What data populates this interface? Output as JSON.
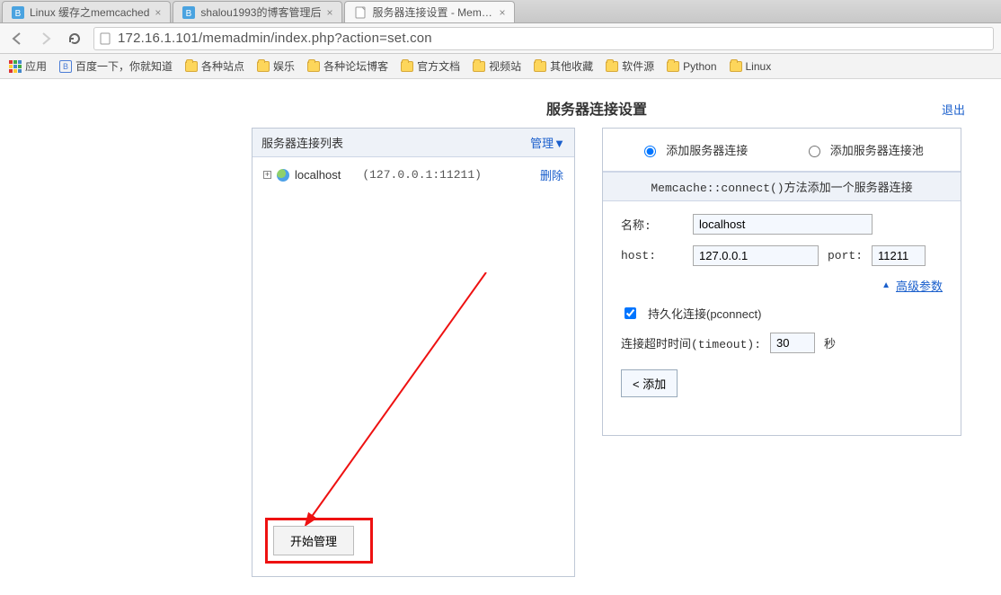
{
  "tabs": [
    {
      "title": "Linux 缓存之memcached",
      "active": false,
      "icon": "blog"
    },
    {
      "title": "shalou1993的博客管理后",
      "active": false,
      "icon": "blog"
    },
    {
      "title": "服务器连接设置 - MemAc",
      "active": true,
      "icon": "page"
    }
  ],
  "url": "172.16.1.101/memadmin/index.php?action=set.con",
  "bookmarks": {
    "apps": "应用",
    "baidu": "百度一下，你就知道",
    "folders": [
      "各种站点",
      "娱乐",
      "各种论坛博客",
      "官方文档",
      "视频站",
      "其他收藏",
      "软件源",
      "Python",
      "Linux"
    ]
  },
  "page": {
    "title": "服务器连接设置",
    "logout": "退出",
    "listTitle": "服务器连接列表",
    "manage": "管理▼",
    "server": {
      "name": "localhost",
      "addr": "(127.0.0.1:11211)",
      "delete": "删除"
    },
    "startManage": "开始管理",
    "radio1": "添加服务器连接",
    "radio2": "添加服务器连接池",
    "methodCaption": "Memcache::connect()方法添加一个服务器连接",
    "labels": {
      "name": "名称:",
      "host": "host:",
      "port": "port:",
      "adv": "高级参数",
      "pconnect": "持久化连接(pconnect)",
      "timeout": "连接超时时间(timeout):",
      "seconds": "秒",
      "addBtn": "< 添加"
    },
    "values": {
      "name": "localhost",
      "host": "127.0.0.1",
      "port": "11211",
      "timeout": "30"
    }
  }
}
